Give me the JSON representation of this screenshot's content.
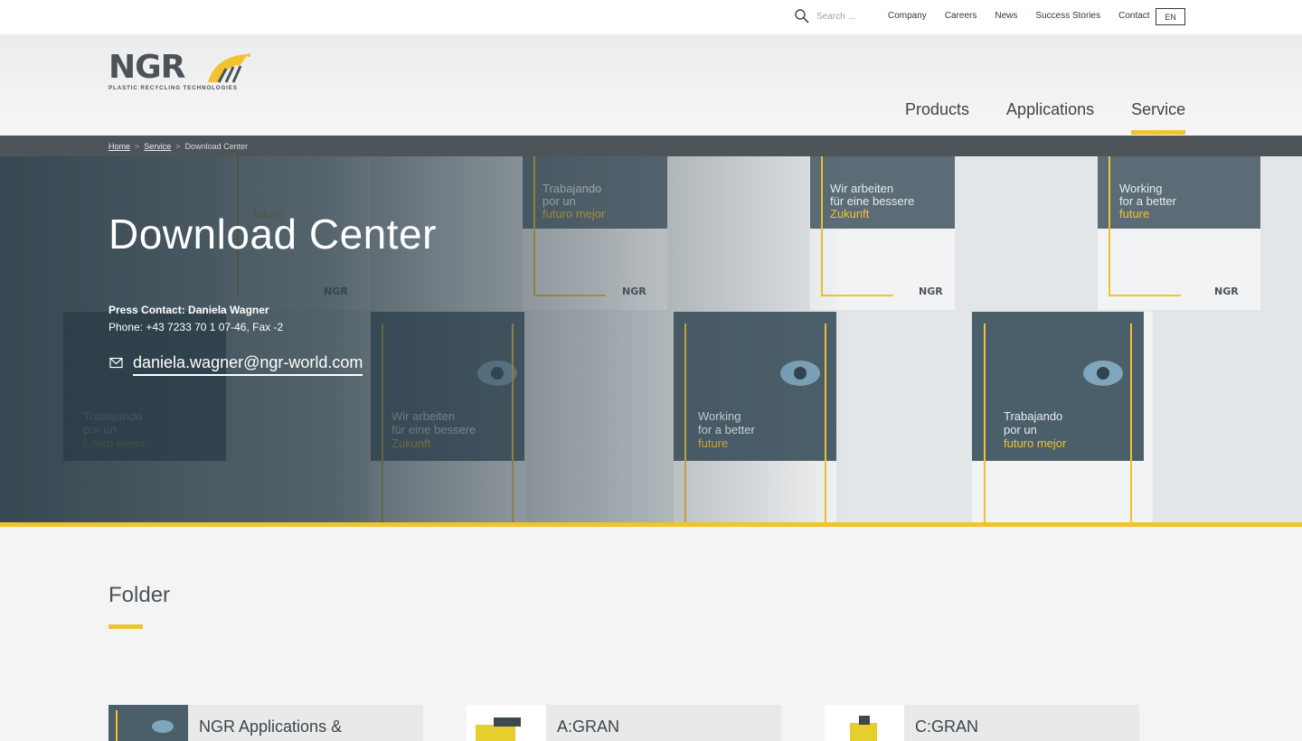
{
  "topbar": {
    "search_placeholder": "Search ...",
    "nav": [
      "Company",
      "Careers",
      "News",
      "Success Stories",
      "Contact"
    ],
    "language": "EN"
  },
  "logo": {
    "text": "NGR",
    "tagline": "PLASTIC RECYCLING TECHNOLOGIES"
  },
  "main_nav": [
    {
      "label": "Products",
      "active": false
    },
    {
      "label": "Applications",
      "active": false
    },
    {
      "label": "Service",
      "active": true
    }
  ],
  "breadcrumb": {
    "home": "Home",
    "service": "Service",
    "current": "Download Center",
    "separator": ">"
  },
  "hero": {
    "title": "Download Center",
    "press_contact": "Press Contact: Daniela Wagner",
    "phone": "Phone: +43 7233 70 1 07-46, Fax -2",
    "email": "daniela.wagner@ngr-world.com",
    "brochure_texts": [
      "Working for a better future",
      "Trabajando por un futuro mejor",
      "Wir arbeiten für eine bessere Zukunft"
    ]
  },
  "section": {
    "title": "Folder"
  },
  "cards": [
    {
      "title": "NGR Applications &"
    },
    {
      "title": "A:GRAN"
    },
    {
      "title": "C:GRAN"
    }
  ],
  "colors": {
    "accent_yellow": "#f2c230",
    "breadcrumb_bg": "#4d5558",
    "text_dark": "#3b464d"
  }
}
